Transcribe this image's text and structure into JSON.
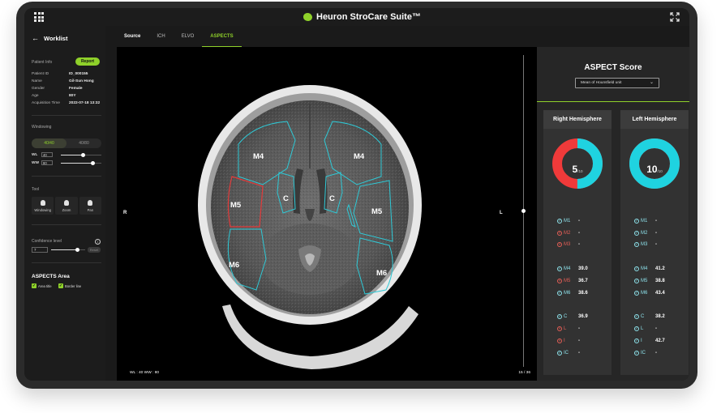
{
  "app": {
    "brand_name": "Heuron StroCare Suite™",
    "brand_color": "#8fd12a"
  },
  "sidebar": {
    "back_label": "Worklist",
    "patient_info_label": "Patient Info",
    "report_label": "Report",
    "patient": [
      {
        "key": "Patient ID",
        "value": "ID_000155"
      },
      {
        "key": "Name",
        "value": "Gil-Sun Hong"
      },
      {
        "key": "Gender",
        "value": "Female"
      },
      {
        "key": "Age",
        "value": "80Y"
      },
      {
        "key": "Acquisition Time",
        "value": "2022-07-18 13:32"
      }
    ],
    "windowing_label": "Windowing",
    "windowing_presets": [
      "40/40",
      "40/80"
    ],
    "wl_label": "WL",
    "wl_value": "40",
    "wl_level": 0.55,
    "ww_label": "WW",
    "ww_value": "80",
    "ww_level": 0.78,
    "tool_label": "Tool",
    "tools": [
      "Windowing",
      "Zoom",
      "Pan"
    ],
    "confidence_label": "Confidence level",
    "confidence_value": "7",
    "confidence_level": 0.78,
    "confidence_button": "Reset",
    "aspects_area_label": "ASPECTS Area",
    "checkboxes": [
      "Area title",
      "Border line"
    ]
  },
  "tabs": [
    "Source",
    "ICH",
    "ELVO",
    "ASPECTS"
  ],
  "active_tab": "ASPECTS",
  "viewer": {
    "left_marker": "R",
    "right_marker": "L",
    "wl_ww_text": "WL : 40  WW : 80",
    "slice_text": "15 / 36",
    "slice_level": 0.5,
    "regions": [
      "M4",
      "M4",
      "M5",
      "M5",
      "C",
      "C",
      "M6",
      "M6"
    ]
  },
  "score": {
    "title": "ASPECT Score",
    "method": "Mean of Hounsfield unit",
    "hemispheres": [
      {
        "title": "Right Hemisphere",
        "score": "5",
        "max": "/10",
        "fraction": 0.5,
        "regions": [
          {
            "name": "M1",
            "status": "ok",
            "value": "-"
          },
          {
            "name": "M2",
            "status": "bad",
            "value": "-"
          },
          {
            "name": "M3",
            "status": "bad",
            "value": "-"
          },
          {
            "name": "M4",
            "status": "ok",
            "value": "39.0"
          },
          {
            "name": "M5",
            "status": "bad",
            "value": "36.7"
          },
          {
            "name": "M6",
            "status": "ok",
            "value": "38.6"
          },
          {
            "name": "C",
            "status": "ok",
            "value": "36.9"
          },
          {
            "name": "L",
            "status": "bad",
            "value": "-"
          },
          {
            "name": "I",
            "status": "bad",
            "value": "-"
          },
          {
            "name": "IC",
            "status": "ok",
            "value": "-"
          }
        ]
      },
      {
        "title": "Left Hemisphere",
        "score": "10",
        "max": "/10",
        "fraction": 1.0,
        "regions": [
          {
            "name": "M1",
            "status": "ok",
            "value": "-"
          },
          {
            "name": "M2",
            "status": "ok",
            "value": "-"
          },
          {
            "name": "M3",
            "status": "ok",
            "value": "-"
          },
          {
            "name": "M4",
            "status": "ok",
            "value": "41.2"
          },
          {
            "name": "M5",
            "status": "ok",
            "value": "38.8"
          },
          {
            "name": "M6",
            "status": "ok",
            "value": "43.4"
          },
          {
            "name": "C",
            "status": "ok",
            "value": "38.2"
          },
          {
            "name": "L",
            "status": "ok",
            "value": "-"
          },
          {
            "name": "I",
            "status": "ok",
            "value": "42.7"
          },
          {
            "name": "IC",
            "status": "ok",
            "value": "-"
          }
        ]
      }
    ],
    "colors": {
      "ok": "#1fd3e0",
      "bad": "#f03a3a"
    }
  }
}
